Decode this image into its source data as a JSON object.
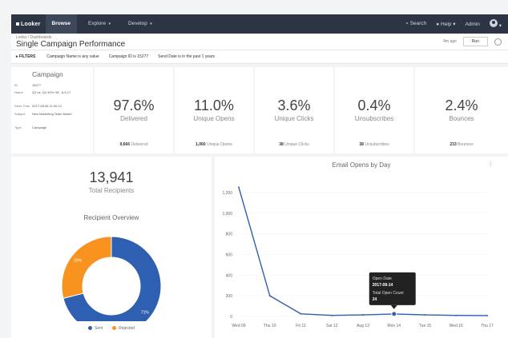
{
  "nav": {
    "logo": "Looker",
    "tabs": [
      {
        "label": "Browse",
        "active": true
      },
      {
        "label": "Explore",
        "active": false
      },
      {
        "label": "Develop",
        "active": false
      }
    ],
    "search": "Search",
    "help": "Help",
    "admin": "Admin"
  },
  "header": {
    "breadcrumb": "Looks / Dashboards",
    "title": "Single Campaign Performance",
    "time_ago": "4m ago",
    "run_label": "Run"
  },
  "filters": {
    "toggle_label": "FILTERS",
    "items": [
      "Campaign Name is any value",
      "Campaign ID is 15277",
      "Send Date is in the past 1 years"
    ]
  },
  "campaign": {
    "title": "Campaign",
    "rows": [
      {
        "key": "ID",
        "value": "15277"
      },
      {
        "key": "Name",
        "value": "Q3 vs. Q4 30% Off - 8.5.17"
      },
      {
        "key": "Send Time",
        "value": "2017-08-08 11:00:12"
      },
      {
        "key": "Subject",
        "value": "New Marketing Team Model"
      },
      {
        "key": "Type",
        "value": "Campaign"
      }
    ]
  },
  "stats": [
    {
      "value": "97.6%",
      "label": "Delivered",
      "count": "9,666",
      "count_label": "Delivered"
    },
    {
      "value": "11.0%",
      "label": "Unique Opens",
      "count": "1,060",
      "count_label": "Unique Opens"
    },
    {
      "value": "3.6%",
      "label": "Unique Clicks",
      "count": "38",
      "count_label": "Unique Clicks"
    },
    {
      "value": "0.4%",
      "label": "Unsubscribes",
      "count": "38",
      "count_label": "Unsubscribes"
    },
    {
      "value": "2.4%",
      "label": "Bounces",
      "count": "233",
      "count_label": "Bounces"
    }
  ],
  "total": {
    "value": "13,941",
    "label": "Total Recipients"
  },
  "overview": {
    "title": "Recipient Overview",
    "legend": [
      {
        "name": "Sent",
        "color": "#2f5fb0"
      },
      {
        "name": "Rejected",
        "color": "#f7931e"
      }
    ]
  },
  "colors": {
    "sent": "#2f5fb0",
    "rejected": "#f7931e",
    "nav_bg": "#2d3545"
  },
  "chart_data": [
    {
      "type": "pie",
      "title": "Recipient Overview",
      "categories": [
        "Sent",
        "Rejected"
      ],
      "values": [
        71,
        29
      ],
      "value_labels": [
        "71%",
        "29%"
      ]
    },
    {
      "type": "line",
      "title": "Email Opens by Day",
      "categories": [
        "Wed 09",
        "Thu 10",
        "Fri 11",
        "Sat 12",
        "Aug 13",
        "Mon 14",
        "Tue 15",
        "Wed 16",
        "Thu 17"
      ],
      "series": [
        {
          "values": [
            1250,
            200,
            25,
            10,
            15,
            24,
            15,
            10,
            8
          ]
        }
      ],
      "ylim": [
        0,
        1300
      ],
      "yticks": [
        0,
        200,
        400,
        600,
        800,
        1000,
        1200
      ],
      "ytick_labels": [
        "0",
        "200",
        "400",
        "600",
        "800",
        "1,000",
        "1,200"
      ],
      "tooltip": {
        "index": 5,
        "date_label": "Open Date",
        "date": "2017-08-14",
        "value_label": "Total Open Count",
        "value": "24"
      }
    }
  ]
}
